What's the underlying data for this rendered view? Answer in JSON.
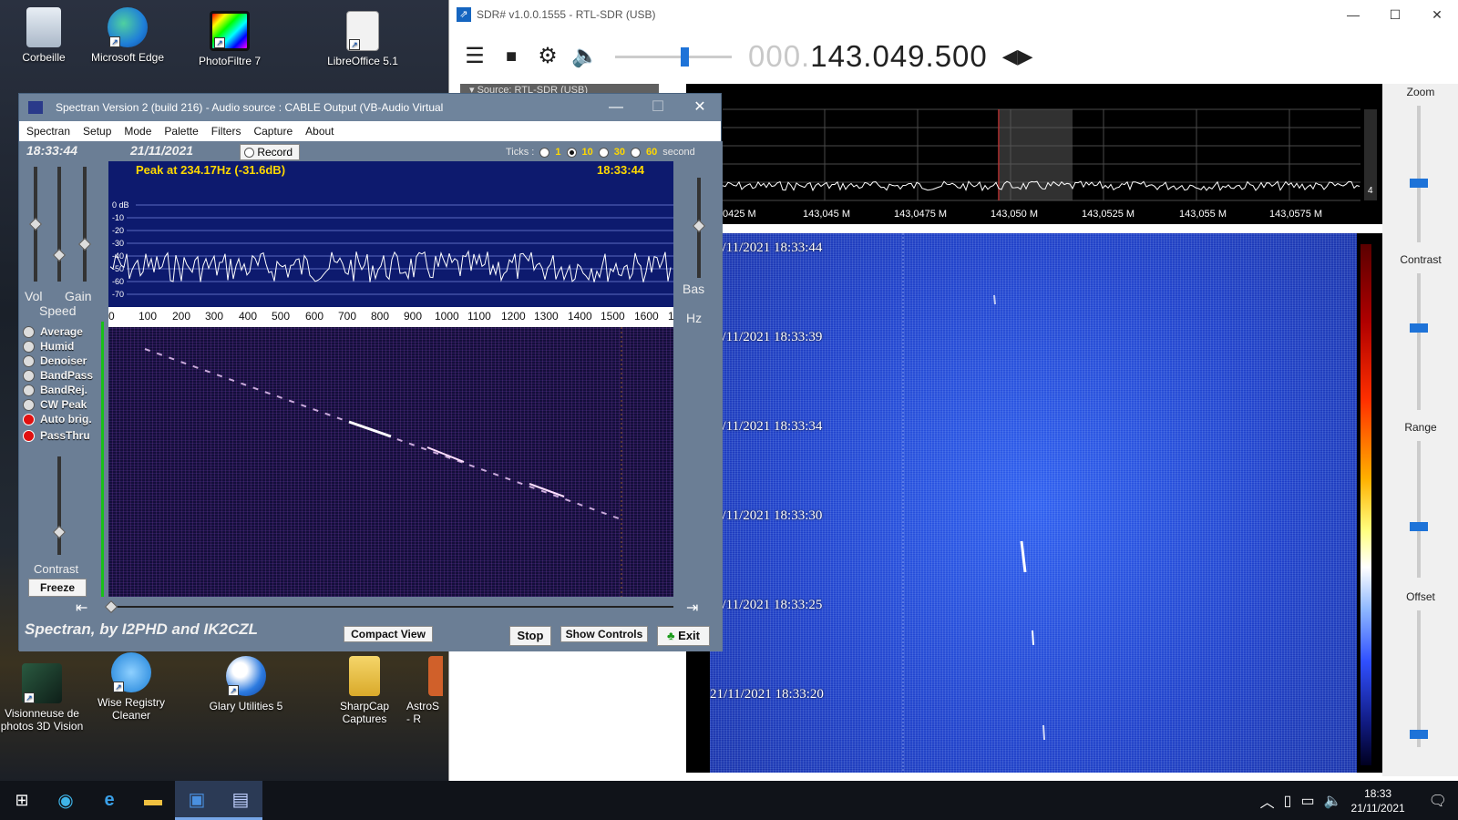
{
  "desktop": {
    "icons_top": [
      {
        "label": "Corbeille"
      },
      {
        "label": "Microsoft Edge"
      },
      {
        "label": "PhotoFiltre 7"
      },
      {
        "label": "LibreOffice 5.1"
      }
    ],
    "icons_bottom": [
      {
        "label": "Visionneuse de photos 3D Vision"
      },
      {
        "label": "Wise Registry Cleaner"
      },
      {
        "label": "Glary Utilities 5"
      },
      {
        "label": "SharpCap Captures"
      },
      {
        "label": "AstroS - R"
      }
    ]
  },
  "sdr": {
    "title": "SDR# v1.0.0.1555 - RTL-SDR (USB)",
    "freq_dim": "000.",
    "freq_main": "143.049.500",
    "source_label": "Source: RTL-SDR (USB)",
    "spectrum_axis": [
      "0425 M",
      "143,045 M",
      "143,0475 M",
      "143,050 M",
      "143,0525 M",
      "143,055 M",
      "143,0575 M"
    ],
    "scale_marker": "4",
    "waterfall_timestamps": [
      "1/11/2021 18:33:44",
      "1/11/2021 18:33:39",
      "1/11/2021 18:33:34",
      "1/11/2021 18:33:30",
      "1/11/2021 18:33:25",
      "21/11/2021 18:33:20"
    ],
    "right_panel": {
      "zoom": "Zoom",
      "contrast": "Contrast",
      "range": "Range",
      "offset": "Offset"
    },
    "window_buttons": {
      "minimize": "—",
      "maximize": "☐",
      "close": "✕"
    }
  },
  "spectran": {
    "title": "Spectran Version 2 (build 216) - Audio source :  CABLE Output (VB-Audio Virtual",
    "menu": [
      "Spectran",
      "Setup",
      "Mode",
      "Palette",
      "Filters",
      "Capture",
      "About"
    ],
    "time": "18:33:44",
    "date": "21/11/2021",
    "record": "Record",
    "ticks_label": "Ticks :",
    "ticks": [
      "1",
      "10",
      "30",
      "60"
    ],
    "ticks_unit": "second",
    "peak": "Peak at  234.17Hz (-31.6dB)",
    "scope_time": "18:33:44",
    "db_labels": [
      "0 dB",
      "-10",
      "-20",
      "-30",
      "-40",
      "-50",
      "-60",
      "-70"
    ],
    "freq_labels": [
      "0",
      "100",
      "200",
      "300",
      "400",
      "500",
      "600",
      "700",
      "800",
      "900",
      "1000",
      "1100",
      "1200",
      "1300",
      "1400",
      "1500",
      "1600",
      "1"
    ],
    "slider_labels": {
      "vol": "Vol",
      "gain": "Gain",
      "speed": "Speed",
      "contrast": "Contrast",
      "bas": "Bas",
      "hz": "Hz"
    },
    "options": [
      "Average",
      "Humid",
      "Denoiser",
      "BandPass",
      "BandRej.",
      "CW Peak",
      "Auto brig.",
      "PassThru"
    ],
    "freeze": "Freeze",
    "credit": "Spectran, by I2PHD and IK2CZL",
    "compact_view": "Compact View",
    "stop": "Stop",
    "show_controls": "Show Controls",
    "exit": "Exit"
  },
  "taskbar": {
    "time": "18:33",
    "date": "21/11/2021"
  }
}
